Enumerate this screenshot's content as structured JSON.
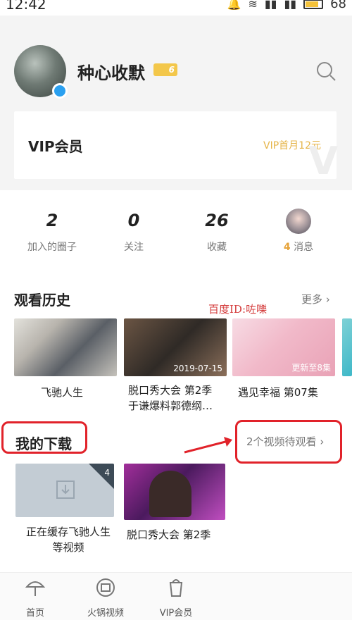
{
  "status_bar": {
    "time": "12:42",
    "battery": "68"
  },
  "profile": {
    "username": "种心收默",
    "level": "6",
    "vip": {
      "title": "VIP会员",
      "promo": "VIP首月12元"
    }
  },
  "stats": [
    {
      "value": "2",
      "label": "加入的圈子"
    },
    {
      "value": "0",
      "label": "关注"
    },
    {
      "value": "26",
      "label": "收藏"
    },
    {
      "count": "4",
      "label": "消息"
    }
  ],
  "history": {
    "title": "观看历史",
    "more": "更多",
    "items": [
      {
        "title": "飞驰人生",
        "caption": ""
      },
      {
        "title_line1": "脱口秀大会 第2季",
        "title_line2": "于谦爆料郭德纲…",
        "caption": "2019-07-15"
      },
      {
        "title": "遇见幸福 第07集",
        "caption": "更新至8集"
      }
    ]
  },
  "watermark": "百度ID:咗嚛",
  "downloads": {
    "title": "我的下载",
    "pending": "2个视频待观看",
    "items": [
      {
        "title_line1": "正在缓存飞驰人生",
        "title_line2": "等视频",
        "count": "4"
      },
      {
        "title": "脱口秀大会 第2季"
      }
    ]
  },
  "bottom_nav": [
    {
      "label": "首页",
      "icon": "umbrella-icon"
    },
    {
      "label": "火锅视频",
      "icon": "video-icon"
    },
    {
      "label": "VIP会员",
      "icon": "vip-cup-icon"
    }
  ],
  "colors": {
    "vip_gold": "#e6b54a",
    "annotation_red": "#e1222a",
    "message_orange": "#e6a33a"
  }
}
